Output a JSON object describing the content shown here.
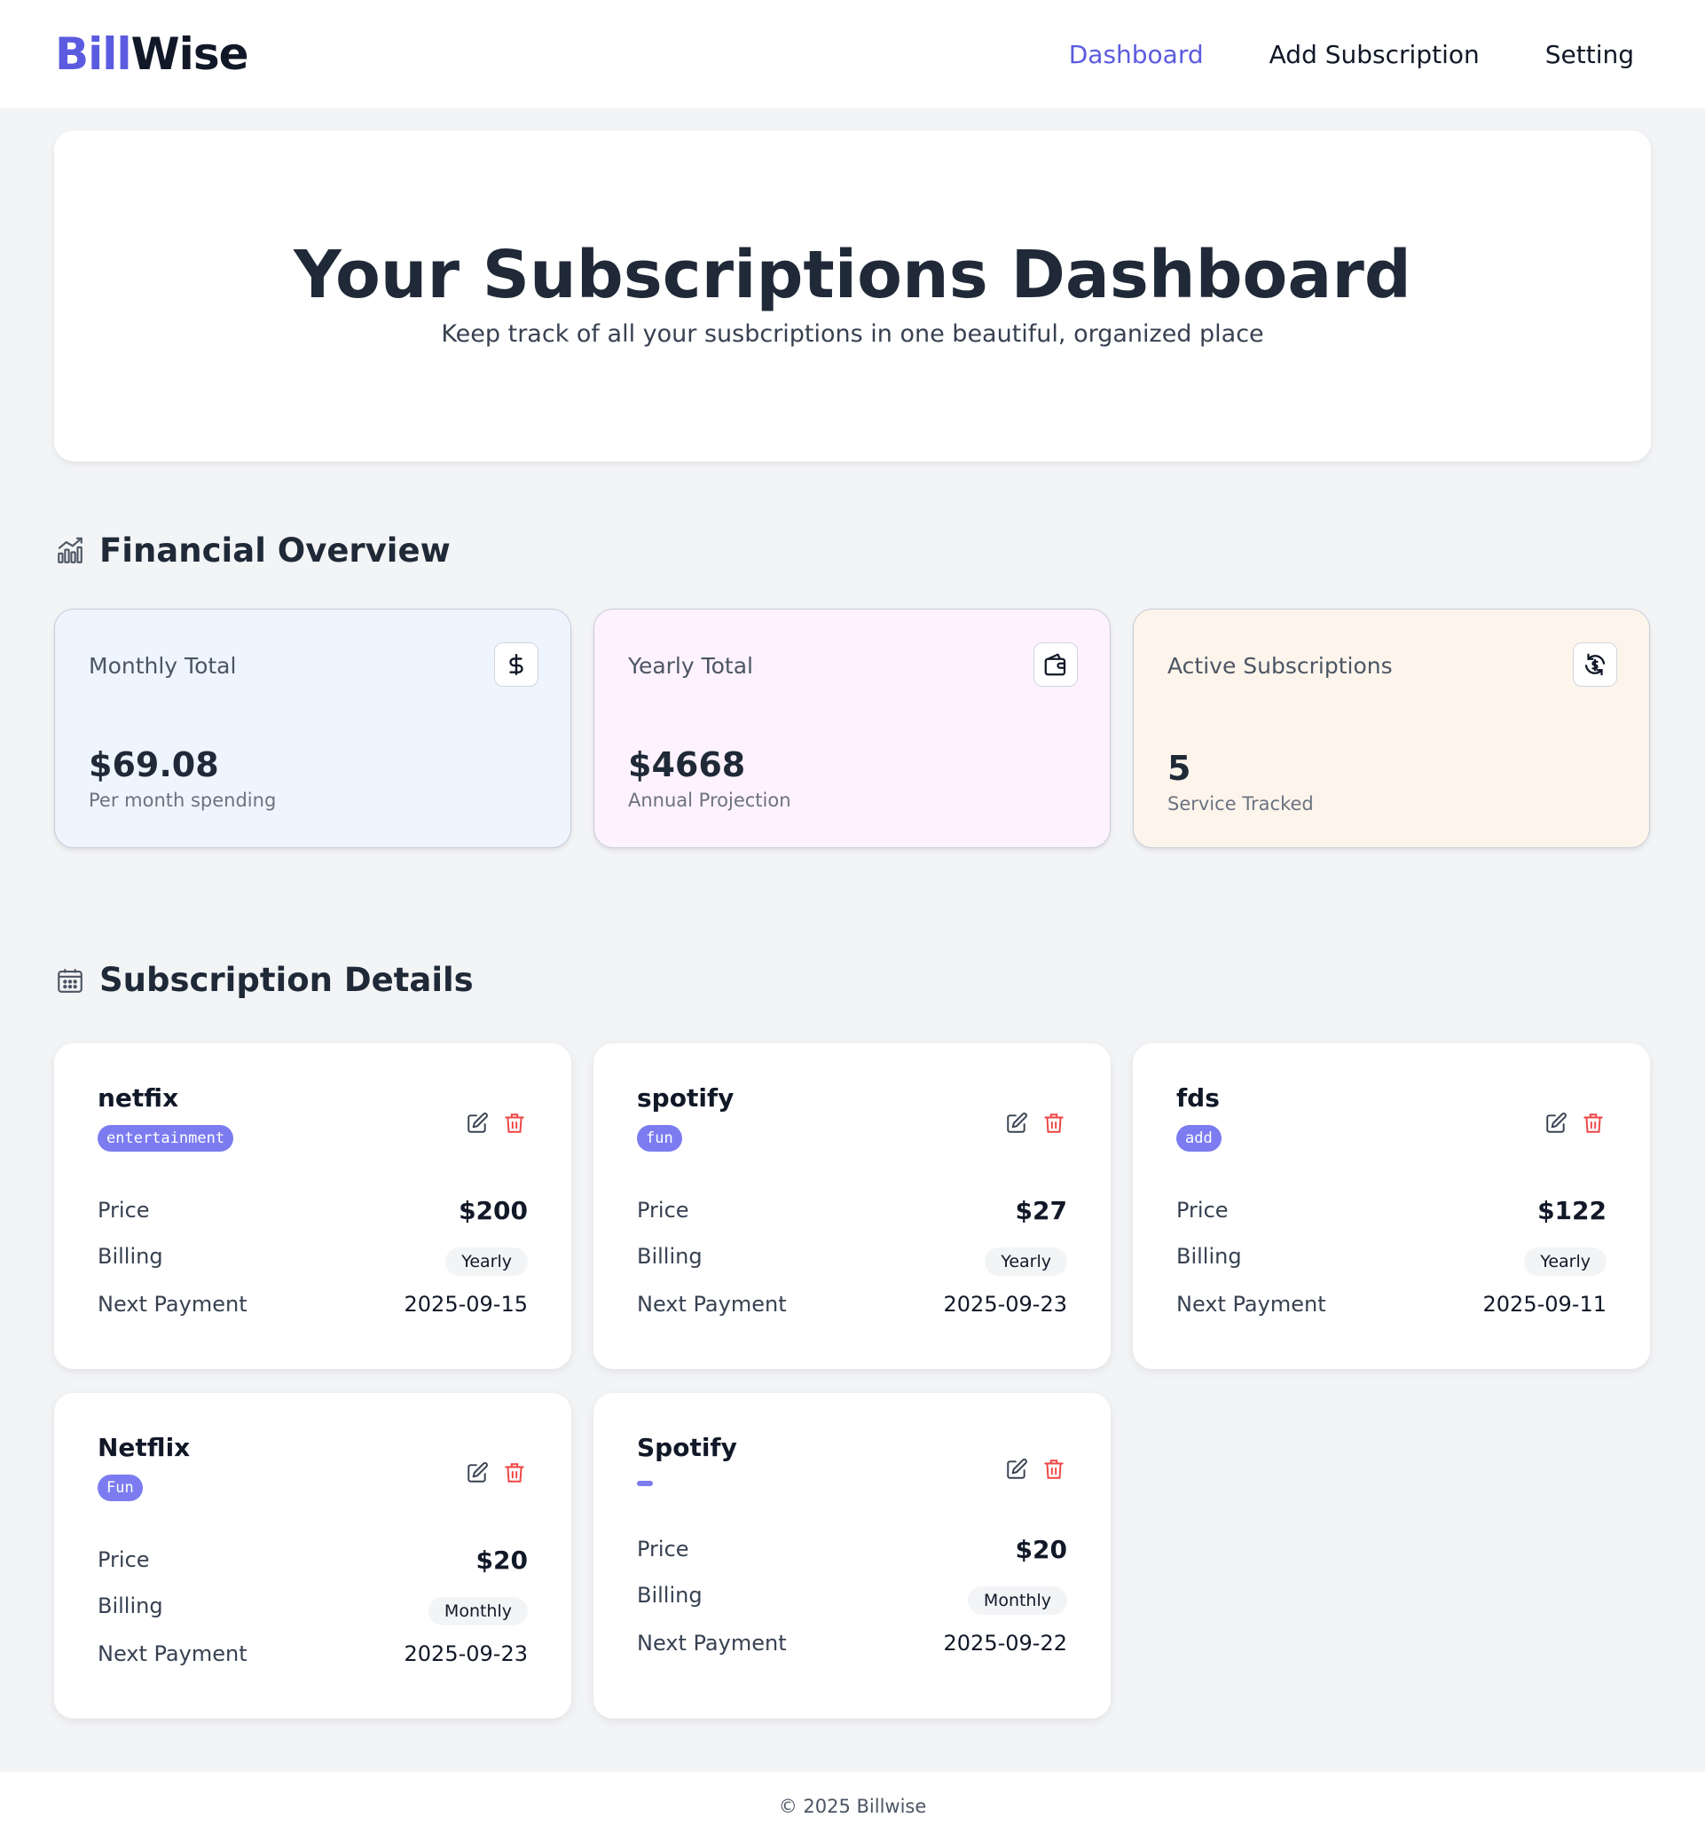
{
  "brand": {
    "part1": "Bill",
    "part2": "Wise"
  },
  "nav": [
    {
      "label": "Dashboard",
      "active": true
    },
    {
      "label": "Add Subscription",
      "active": false
    },
    {
      "label": "Setting",
      "active": false
    }
  ],
  "hero": {
    "title": "Your Subscriptions Dashboard",
    "subtitle": "Keep track of all your susbcriptions in one beautiful, organized place"
  },
  "overview": {
    "title": "Financial Overview",
    "icon": "chart-icon",
    "cards": [
      {
        "label": "Monthly Total",
        "icon": "dollar-icon",
        "value": "$69.08",
        "caption": "Per month spending",
        "bg": "#eff5ff"
      },
      {
        "label": "Yearly Total",
        "icon": "wallet-icon",
        "value": "$4668",
        "caption": "Annual Projection",
        "bg": "#fdf2fd"
      },
      {
        "label": "Active Subscriptions",
        "icon": "refresh-dollar-icon",
        "value": "5",
        "caption": "Service Tracked",
        "bg": "#fdf5ec"
      }
    ]
  },
  "details": {
    "title": "Subscription Details",
    "icon": "calendar-icon",
    "row_labels": {
      "price": "Price",
      "billing": "Billing",
      "next": "Next Payment"
    },
    "subscriptions": [
      {
        "name": "netfix",
        "tag": "entertainment",
        "price": "$200",
        "billing": "Yearly",
        "next": "2025-09-15"
      },
      {
        "name": "spotify",
        "tag": "fun",
        "price": "$27",
        "billing": "Yearly",
        "next": "2025-09-23"
      },
      {
        "name": "fds",
        "tag": "add",
        "price": "$122",
        "billing": "Yearly",
        "next": "2025-09-11"
      },
      {
        "name": "Netflix",
        "tag": "Fun",
        "price": "$20",
        "billing": "Monthly",
        "next": "2025-09-23"
      },
      {
        "name": "Spotify",
        "tag": "",
        "price": "$20",
        "billing": "Monthly",
        "next": "2025-09-22"
      }
    ]
  },
  "footer": {
    "text": "© 2025 Billwise"
  },
  "colors": {
    "accent": "#5b5be0",
    "tag": "#7c7cf0",
    "delete": "#ef4444"
  }
}
